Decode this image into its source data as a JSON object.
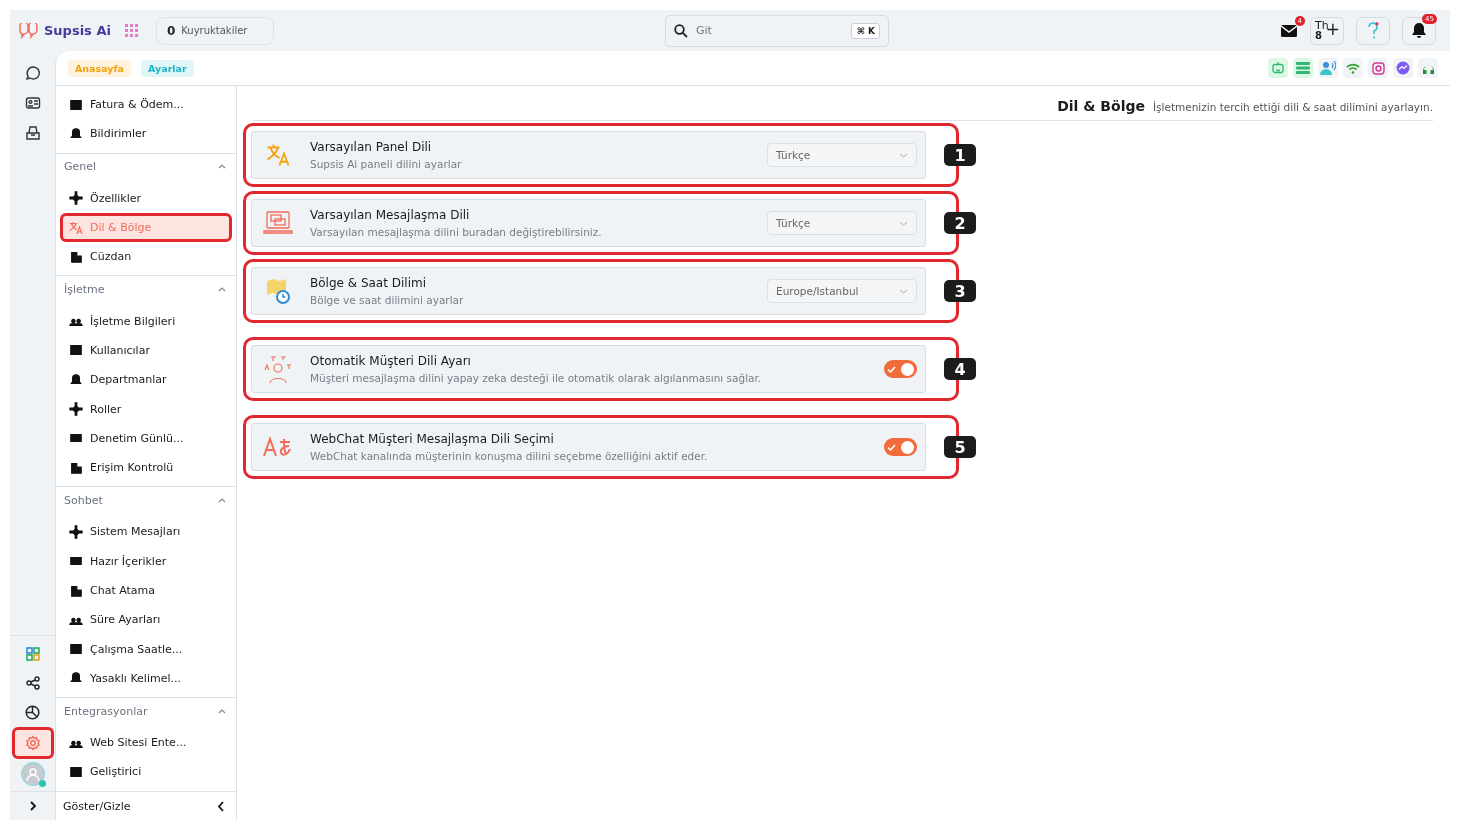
{
  "topbar": {
    "logo": "Supsis Ai",
    "queue": {
      "count": "0",
      "label": "Kuyruktakiler"
    },
    "search": {
      "placeholder": "Git",
      "shortcut": "⌘ K"
    },
    "mail_badge": "4",
    "agent": {
      "label": "Th",
      "count": "8",
      "action": "+"
    },
    "bell_badge": "45"
  },
  "breadcrumbs": [
    {
      "label": "Anasayfa",
      "color": "#f5a10a"
    },
    {
      "label": "Ayarlar",
      "color": "#1fb5c4"
    }
  ],
  "rail": {
    "top_items": [
      {
        "selected": false
      },
      {
        "selected": false
      },
      {
        "selected": false
      }
    ],
    "bottom_items": [
      {
        "selected": false,
        "highlighted": false
      },
      {
        "selected": false,
        "highlighted": false
      },
      {
        "selected": false,
        "highlighted": false
      },
      {
        "selected": true,
        "highlighted": true
      }
    ]
  },
  "sidebar": {
    "top_items": [
      {
        "label": "Fatura & Ödem...",
        "selected": false,
        "highlighted": false
      },
      {
        "label": "Bildirimler",
        "selected": false,
        "highlighted": false
      }
    ],
    "sections": [
      {
        "title": "Genel",
        "expanded": true,
        "items": [
          {
            "label": "Özellikler",
            "selected": false,
            "highlighted": false
          },
          {
            "label": "Dil & Bölge",
            "selected": true,
            "highlighted": true
          },
          {
            "label": "Cüzdan",
            "selected": false,
            "highlighted": false
          }
        ]
      },
      {
        "title": "İşletme",
        "expanded": true,
        "items": [
          {
            "label": "İşletme Bilgileri",
            "selected": false,
            "highlighted": false
          },
          {
            "label": "Kullanıcılar",
            "selected": false,
            "highlighted": false
          },
          {
            "label": "Departmanlar",
            "selected": false,
            "highlighted": false
          },
          {
            "label": "Roller",
            "selected": false,
            "highlighted": false
          },
          {
            "label": "Denetim Günlü...",
            "selected": false,
            "highlighted": false
          },
          {
            "label": "Erişim Kontrolü",
            "selected": false,
            "highlighted": false
          }
        ]
      },
      {
        "title": "Sohbet",
        "expanded": true,
        "items": [
          {
            "label": "Sistem Mesajları",
            "selected": false,
            "highlighted": false
          },
          {
            "label": "Hazır İçerikler",
            "selected": false,
            "highlighted": false
          },
          {
            "label": "Chat Atama",
            "selected": false,
            "highlighted": false
          },
          {
            "label": "Süre Ayarları",
            "selected": false,
            "highlighted": false
          },
          {
            "label": "Çalışma Saatle...",
            "selected": false,
            "highlighted": false
          },
          {
            "label": "Yasaklı Kelimel...",
            "selected": false,
            "highlighted": false
          }
        ]
      },
      {
        "title": "Entegrasyonlar",
        "expanded": true,
        "items": [
          {
            "label": "Web Sitesi Ente...",
            "selected": false,
            "highlighted": false
          },
          {
            "label": "Geliştirici",
            "selected": false,
            "highlighted": false
          }
        ]
      }
    ],
    "footer": "Göster/Gizle"
  },
  "page": {
    "title": "Dil & Bölge",
    "subtitle": "İşletmenizin tercih ettiği dili & saat dilimini ayarlayın."
  },
  "settings": [
    {
      "kind": "select",
      "title": "Varsayılan Panel Dili",
      "description": "Supsis Ai paneli dilini ayarlar",
      "value": "Türkçe",
      "callout": "1",
      "highlighted": true
    },
    {
      "kind": "select",
      "title": "Varsayılan Mesajlaşma Dili",
      "description": "Varsayılan mesajlaşma dilini buradan değiştirebilirsiniz.",
      "value": "Türkçe",
      "callout": "2",
      "highlighted": true
    },
    {
      "kind": "select",
      "title": "Bölge & Saat Dilimi",
      "description": "Bölge ve saat dilimini ayarlar",
      "value": "Europe/Istanbul",
      "callout": "3",
      "highlighted": true
    },
    {
      "kind": "toggle",
      "title": "Otomatik Müşteri Dili Ayarı",
      "description": "Müşteri mesajlaşma dilini yapay zeka desteği ile otomatik olarak algılanmasını sağlar.",
      "on": true,
      "callout": "4",
      "highlighted": true
    },
    {
      "kind": "toggle",
      "title": "WebChat Müşteri Mesajlaşma Dili Seçimi",
      "description": "WebChat kanalında müşterinin konuşma dilini seçebme özelliğini aktif eder.",
      "on": true,
      "callout": "5",
      "highlighted": true
    }
  ]
}
